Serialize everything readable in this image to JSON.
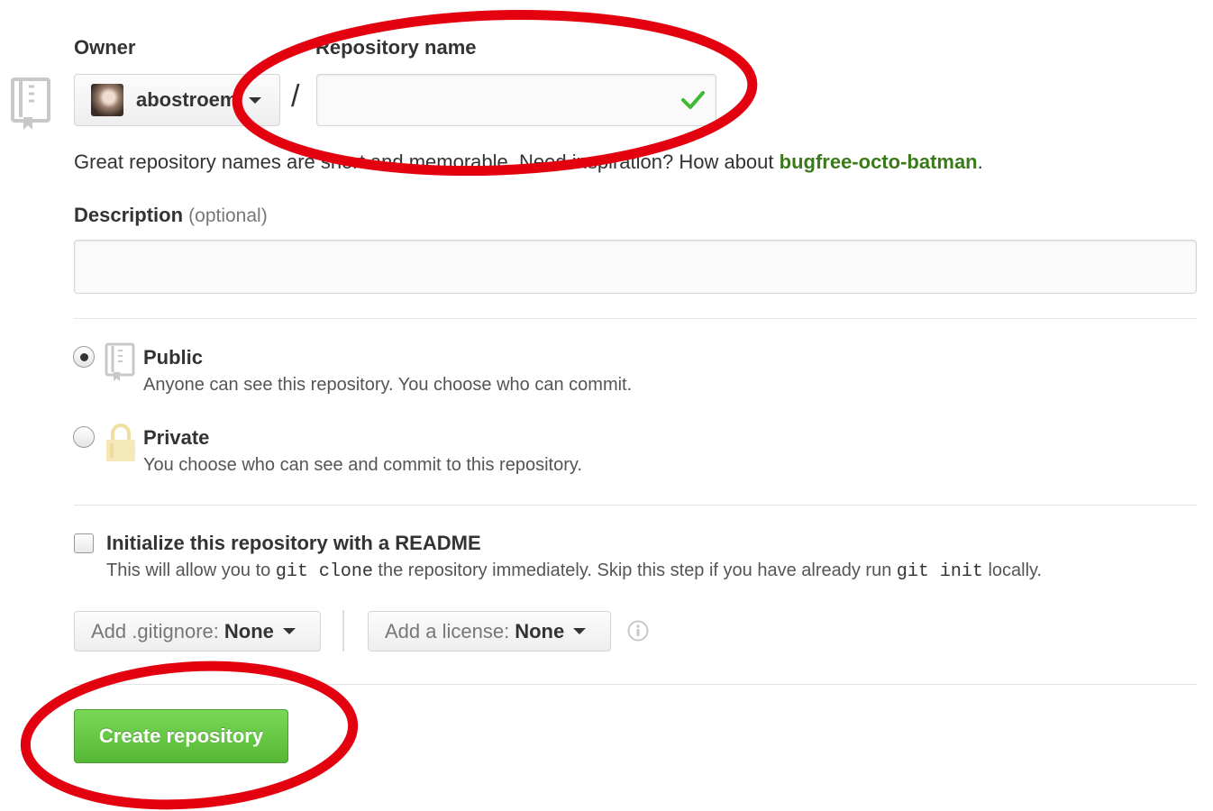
{
  "owner": {
    "label": "Owner",
    "name": "abostroem",
    "avatar_icon": "user-avatar"
  },
  "separator": "/",
  "repository_name": {
    "label": "Repository name",
    "value": "",
    "status_icon": "check-icon"
  },
  "hint": {
    "text_before": "Great repository names are short and memorable. Need inspiration? How about ",
    "suggestion": "bugfree-octo-batman",
    "text_after": "."
  },
  "description": {
    "label": "Description",
    "optional": "(optional)",
    "value": ""
  },
  "visibility": {
    "selected": "public",
    "public": {
      "title": "Public",
      "description": "Anyone can see this repository. You choose who can commit.",
      "icon": "repo-icon"
    },
    "private": {
      "title": "Private",
      "description": "You choose who can see and commit to this repository.",
      "icon": "lock-icon"
    }
  },
  "readme": {
    "checked": false,
    "title": "Initialize this repository with a README",
    "desc_1": "This will allow you to ",
    "code_1": "git clone",
    "desc_2": " the repository immediately. Skip this step if you have already run ",
    "code_2": "git init",
    "desc_3": " locally."
  },
  "gitignore": {
    "label": "Add .gitignore:",
    "value": "None"
  },
  "license": {
    "label": "Add a license:",
    "value": "None",
    "info_icon": "info-icon"
  },
  "create_button": {
    "label": "Create repository"
  },
  "colors": {
    "suggestion": "#3b7a1a",
    "create_button": "#6cc644",
    "annotation_circle": "#e3000f",
    "check": "#44b734"
  }
}
